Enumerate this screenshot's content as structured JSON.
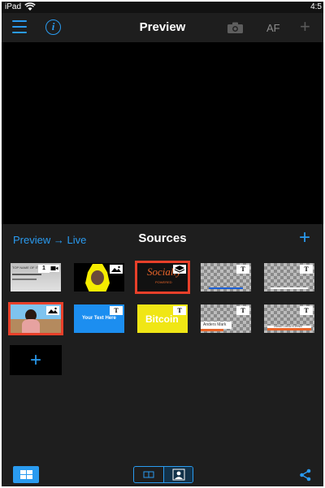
{
  "status_bar": {
    "carrier": "iPad",
    "time": "4:5"
  },
  "nav": {
    "title": "Preview",
    "af_label": "AF"
  },
  "sources": {
    "switch_label": "Preview → Live",
    "title": "Sources",
    "tiles": [
      {
        "name": "camera-source",
        "selected": false,
        "text_lines": [
          "TOP NAME OF ITEM",
          "1"
        ]
      },
      {
        "name": "snapchat-source",
        "selected": false
      },
      {
        "name": "socially-powered-source",
        "selected": true,
        "text_lines": [
          "Socially",
          "POWERED"
        ]
      },
      {
        "name": "text-overlay-source",
        "selected": false
      },
      {
        "name": "text-overlay-source",
        "selected": false
      },
      {
        "name": "image-source",
        "selected": true
      },
      {
        "name": "text-source",
        "selected": false,
        "text_lines": [
          "Your Text Here"
        ]
      },
      {
        "name": "bitcoin-source",
        "selected": false,
        "text_lines": [
          "Bitcoin"
        ]
      },
      {
        "name": "lower-third-source",
        "selected": false,
        "text_lines": [
          "Anders Mark"
        ]
      },
      {
        "name": "lower-third-source",
        "selected": false,
        "text_lines": [
          "ANDER LARGE FLIPPED"
        ]
      }
    ]
  },
  "colors": {
    "accent": "#2a9bf0",
    "selection": "#e8402a",
    "background": "#1e1e1e"
  },
  "icons": [
    "menu-icon",
    "info-icon",
    "camera-icon",
    "add-icon",
    "grid-view-icon",
    "single-view-icon",
    "portrait-view-icon",
    "share-icon",
    "image-icon",
    "text-icon",
    "layers-icon",
    "video-camera-icon"
  ]
}
